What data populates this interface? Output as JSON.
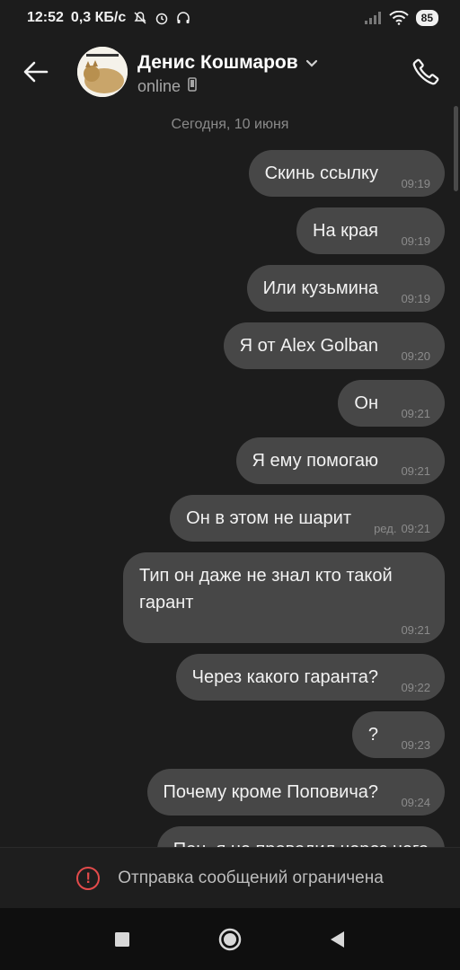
{
  "status_bar": {
    "time": "12:52",
    "network_speed": "0,3 КБ/с",
    "battery": "85",
    "icons": [
      "bell-off-icon",
      "alarm-icon",
      "headphones-icon",
      "signal-icon",
      "wifi-icon",
      "battery-icon"
    ]
  },
  "header": {
    "contact_name": "Денис Кошмаров",
    "status": "online",
    "icons": [
      "back-arrow-icon",
      "chevron-down-icon",
      "mobile-device-icon",
      "phone-icon"
    ]
  },
  "chat": {
    "date_separator": "Сегодня, 10 июня",
    "messages": [
      {
        "text": "Скинь ссылку",
        "time": "09:19",
        "edited": ""
      },
      {
        "text": "На края",
        "time": "09:19",
        "edited": ""
      },
      {
        "text": "Или кузьмина",
        "time": "09:19",
        "edited": ""
      },
      {
        "text": "Я от Alex Golban",
        "time": "09:20",
        "edited": ""
      },
      {
        "text": "Он",
        "time": "09:21",
        "edited": ""
      },
      {
        "text": "Я ему помогаю",
        "time": "09:21",
        "edited": ""
      },
      {
        "text": "Он в этом не шарит",
        "time": "09:21",
        "edited": "ред."
      },
      {
        "text": "Тип он даже не знал кто такой гарант",
        "time": "09:21",
        "edited": ""
      },
      {
        "text": "Через какого гаранта?",
        "time": "09:22",
        "edited": ""
      },
      {
        "text": "?",
        "time": "09:23",
        "edited": ""
      },
      {
        "text": "Почему кроме Поповича?",
        "time": "09:24",
        "edited": ""
      },
      {
        "text": "Пон, я не проводил через него",
        "time": "",
        "edited": ""
      }
    ]
  },
  "restriction_banner": {
    "text": "Отправка сообщений ограничена",
    "icon": "warning-circle-icon",
    "color": "#e34b4b"
  },
  "nav_bar": {
    "icons": [
      "recents-square-icon",
      "home-circle-icon",
      "back-triangle-icon"
    ]
  }
}
